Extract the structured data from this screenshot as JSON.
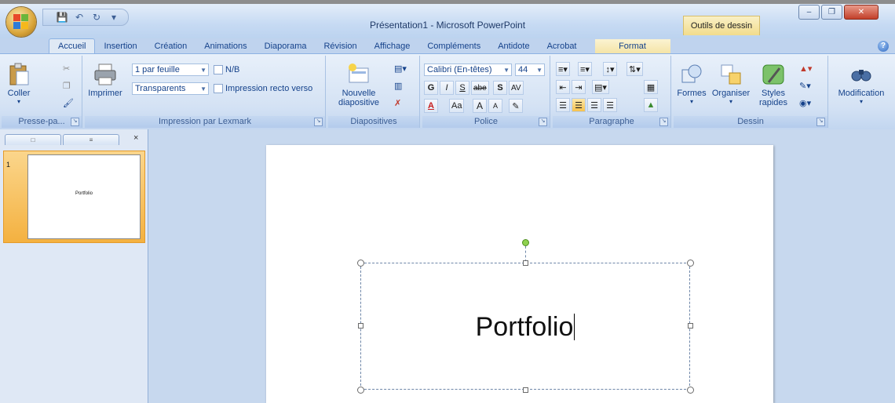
{
  "window": {
    "title": "Présentation1 - Microsoft PowerPoint",
    "contextual_tab_group": "Outils de dessin"
  },
  "tabs": [
    {
      "label": "Accueil",
      "active": true
    },
    {
      "label": "Insertion"
    },
    {
      "label": "Création"
    },
    {
      "label": "Animations"
    },
    {
      "label": "Diaporama"
    },
    {
      "label": "Révision"
    },
    {
      "label": "Affichage"
    },
    {
      "label": "Compléments"
    },
    {
      "label": "Antidote"
    },
    {
      "label": "Acrobat"
    },
    {
      "label": "Format"
    }
  ],
  "ribbon": {
    "clipboard": {
      "label": "Presse-pa...",
      "paste": "Coller"
    },
    "print": {
      "label": "Impression par Lexmark",
      "print_button": "Imprimer",
      "pages_per_sheet": "1 par feuille",
      "nb": "N/B",
      "transparents": "Transparents",
      "duplex": "Impression recto verso"
    },
    "slides": {
      "label": "Diapositives",
      "new_slide_1": "Nouvelle",
      "new_slide_2": "diapositive"
    },
    "font": {
      "label": "Police",
      "family": "Calibri (En-têtes)",
      "size": "44",
      "bold": "G",
      "italic": "I",
      "underline": "S",
      "strike": "abe",
      "shadow": "S",
      "spacing": "AV",
      "color": "A",
      "case": "Aa",
      "grow": "A",
      "shrink": "A"
    },
    "paragraph": {
      "label": "Paragraphe"
    },
    "drawing": {
      "label": "Dessin",
      "shapes": "Formes",
      "arrange": "Organiser",
      "quick_styles_1": "Styles",
      "quick_styles_2": "rapides"
    },
    "editing": {
      "label": "Modification"
    }
  },
  "slides_panel": {
    "slide_number": "1",
    "thumb_title": "Portfolio"
  },
  "slide": {
    "title_text": "Portfolio"
  },
  "colors": {
    "ribbon_bg": "#d4e2f4",
    "selected_thumb": "#f4b140",
    "rotate_handle": "#8fd14f"
  }
}
